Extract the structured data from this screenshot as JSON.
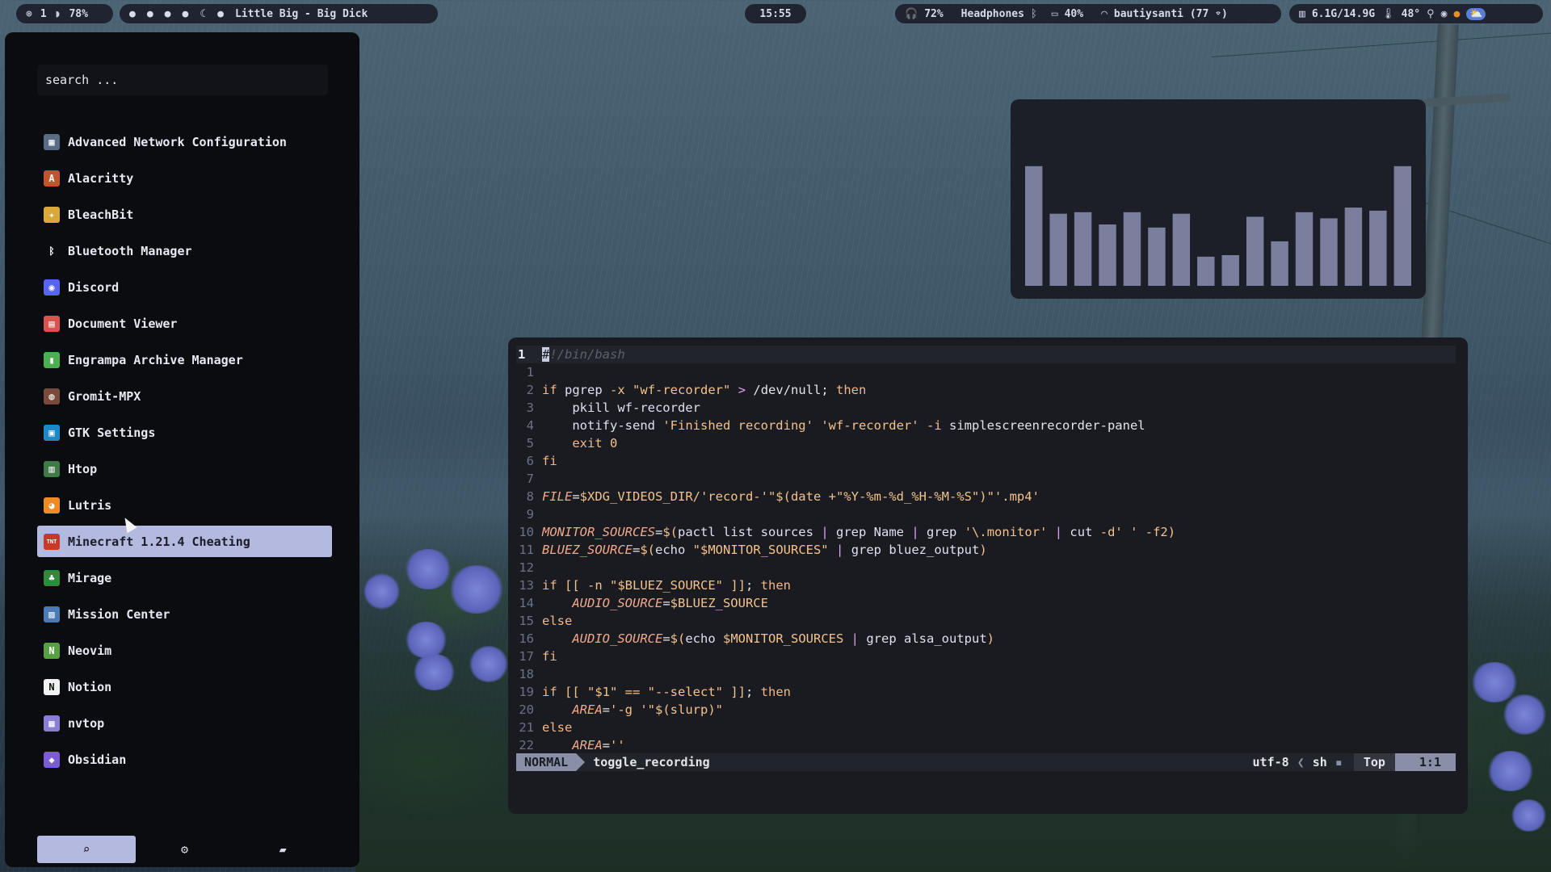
{
  "topbar": {
    "workspace": "1",
    "workspace_icon": "grid-icon",
    "battery_pct": "78%",
    "workspace_dots": [
      "●",
      "●",
      "●",
      "●",
      "☾",
      "●"
    ],
    "now_playing": "Little Big - Big Dick",
    "clock": "15:55",
    "volume": "72%",
    "audio_device": "Headphones",
    "battery2": "40%",
    "wifi": "bautiysanti (77 ⌔)",
    "memory": "6.1G/14.9G",
    "temperature": "48°"
  },
  "launcher": {
    "search_placeholder": "search ...",
    "apps": [
      {
        "label": "Advanced Network Configuration",
        "icon": "network-icon",
        "color": "#5a6b86",
        "glyph": "▦"
      },
      {
        "label": "Alacritty",
        "icon": "alacritty-icon",
        "color": "#c2542b",
        "glyph": "A"
      },
      {
        "label": "BleachBit",
        "icon": "broom-icon",
        "color": "#d8a93a",
        "glyph": "✦"
      },
      {
        "label": "Bluetooth Manager",
        "icon": "bluetooth-icon",
        "color": "#0b0c10",
        "glyph": "ᛒ"
      },
      {
        "label": "Discord",
        "icon": "discord-icon",
        "color": "#5865f2",
        "glyph": "◉"
      },
      {
        "label": "Document Viewer",
        "icon": "document-icon",
        "color": "#d9534f",
        "glyph": "▤"
      },
      {
        "label": "Engrampa Archive Manager",
        "icon": "archive-icon",
        "color": "#4caf50",
        "glyph": "▮"
      },
      {
        "label": "Gromit-MPX",
        "icon": "gromit-icon",
        "color": "#7a4b3a",
        "glyph": "◍"
      },
      {
        "label": "GTK Settings",
        "icon": "gtk-settings-icon",
        "color": "#1e88c8",
        "glyph": "▣"
      },
      {
        "label": "Htop",
        "icon": "htop-icon",
        "color": "#3d7a46",
        "glyph": "▥"
      },
      {
        "label": "Lutris",
        "icon": "lutris-icon",
        "color": "#f08a24",
        "glyph": "◕"
      },
      {
        "label": "Minecraft 1.21.4 Cheating",
        "icon": "minecraft-tnt-icon",
        "color": "#c73a2a",
        "glyph": "TNT"
      },
      {
        "label": "Mirage",
        "icon": "palm-tree-icon",
        "color": "#2f8a3a",
        "glyph": "♣"
      },
      {
        "label": "Mission Center",
        "icon": "mission-center-icon",
        "color": "#4a7bb7",
        "glyph": "▨"
      },
      {
        "label": "Neovim",
        "icon": "neovim-icon",
        "color": "#57a143",
        "glyph": "N"
      },
      {
        "label": "Notion",
        "icon": "notion-icon",
        "color": "#f2f2f2",
        "glyph": "N"
      },
      {
        "label": "nvtop",
        "icon": "nvtop-icon",
        "color": "#8b7fd4",
        "glyph": "▩"
      },
      {
        "label": "Obsidian",
        "icon": "obsidian-icon",
        "color": "#7c5cd6",
        "glyph": "◆"
      }
    ],
    "selected_index": 11,
    "bottom_buttons": [
      {
        "icon": "search-icon",
        "glyph": "⌕"
      },
      {
        "icon": "gear-icon",
        "glyph": "⚙"
      },
      {
        "icon": "folder-icon",
        "glyph": "▰"
      }
    ]
  },
  "visualizer": {
    "bar_color": "#7b7f9e",
    "levels": [
      0.78,
      0.47,
      0.48,
      0.4,
      0.48,
      0.38,
      0.47,
      0.19,
      0.2,
      0.45,
      0.29,
      0.48,
      0.44,
      0.51,
      0.49,
      0.78
    ]
  },
  "editor": {
    "current_line_number": "1",
    "lines": [
      {
        "n": "",
        "html": "<span class=\"cursorblock\">#</span><span class=\"c\">!/bin/bash</span>",
        "cur": true
      },
      {
        "n": "1",
        "html": ""
      },
      {
        "n": "2",
        "html": "<span class=\"k\">if</span> <span class=\"cmd\">pgrep</span> <span class=\"s\">-x \"wf-recorder\"</span> <span class=\"op\">&gt;</span> /dev/null; <span class=\"k\">then</span>"
      },
      {
        "n": "3",
        "html": "    <span class=\"cmd\">pkill wf-recorder</span>"
      },
      {
        "n": "4",
        "html": "    <span class=\"cmd\">notify-send</span> <span class=\"s\">'Finished recording'</span> <span class=\"s\">'wf-recorder'</span> <span class=\"s\">-i</span> simplescreenrecorder-panel"
      },
      {
        "n": "5",
        "html": "    <span class=\"k\">exit</span> <span class=\"s\">0</span>"
      },
      {
        "n": "6",
        "html": "<span class=\"k\">fi</span>"
      },
      {
        "n": "7",
        "html": ""
      },
      {
        "n": "8",
        "html": "<span class=\"v\">FILE</span>=<span class=\"s\">$XDG_VIDEOS_DIR/'record-'\"$(date +\"%Y-%m-%d_%H-%M-%S\")\"'.mp4'</span>"
      },
      {
        "n": "9",
        "html": ""
      },
      {
        "n": "10",
        "html": "<span class=\"v\">MONITOR_SOURCES</span>=<span class=\"s\">$(</span><span class=\"cmd\">pactl list sources</span> <span class=\"op\">|</span> <span class=\"cmd\">grep Name</span> <span class=\"op\">|</span> <span class=\"cmd\">grep</span> <span class=\"s\">'\\.monitor'</span> <span class=\"op\">|</span> <span class=\"cmd\">cut</span> <span class=\"s\">-d' ' -f2)</span>"
      },
      {
        "n": "11",
        "html": "<span class=\"v\">BLUEZ_SOURCE</span>=<span class=\"s\">$(</span><span class=\"cmd\">echo</span> <span class=\"s\">\"$MONITOR_SOURCES\"</span> <span class=\"op\">|</span> <span class=\"cmd\">grep bluez_output</span><span class=\"s\">)</span>"
      },
      {
        "n": "12",
        "html": ""
      },
      {
        "n": "13",
        "html": "<span class=\"k\">if</span> <span class=\"s\">[[ -n \"$BLUEZ_SOURCE\" ]]</span>; <span class=\"k\">then</span>"
      },
      {
        "n": "14",
        "html": "    <span class=\"v\">AUDIO_SOURCE</span>=<span class=\"s\">$BLUEZ_SOURCE</span>"
      },
      {
        "n": "15",
        "html": "<span class=\"k\">else</span>"
      },
      {
        "n": "16",
        "html": "    <span class=\"v\">AUDIO_SOURCE</span>=<span class=\"s\">$(</span><span class=\"cmd\">echo</span> <span class=\"s\">$MONITOR_SOURCES</span> <span class=\"op\">|</span> <span class=\"cmd\">grep alsa_output</span><span class=\"s\">)</span>"
      },
      {
        "n": "17",
        "html": "<span class=\"k\">fi</span>"
      },
      {
        "n": "18",
        "html": ""
      },
      {
        "n": "19",
        "html": "<span class=\"k\">if</span> <span class=\"s\">[[ \"$1\" == \"--select\" ]]</span>; <span class=\"k\">then</span>"
      },
      {
        "n": "20",
        "html": "    <span class=\"v\">AREA</span>=<span class=\"s\">'-g '\"$(slurp)\"</span>"
      },
      {
        "n": "21",
        "html": "<span class=\"k\">else</span>"
      },
      {
        "n": "22",
        "html": "    <span class=\"v\">AREA</span>=<span class=\"s\">''</span>"
      }
    ],
    "status": {
      "mode": "NORMAL",
      "filename": "toggle_recording",
      "encoding": "utf-8",
      "filetype": "sh",
      "position": "Top",
      "cursor": "1:1"
    }
  }
}
